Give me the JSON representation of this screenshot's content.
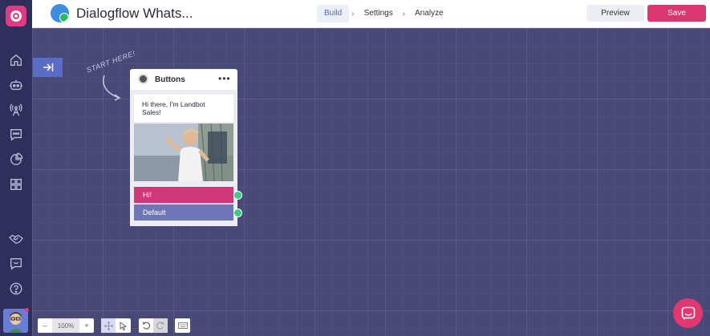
{
  "topbar": {
    "bot_title": "Dialogflow Whats...",
    "nav": [
      {
        "label": "Build",
        "active": true
      },
      {
        "label": "Settings",
        "active": false
      },
      {
        "label": "Analyze",
        "active": false
      }
    ],
    "nav_separator": "›",
    "preview_label": "Preview",
    "save_label": "Save"
  },
  "sidebar": {
    "icons": [
      "home-icon",
      "bot-icon",
      "broadcast-icon",
      "chat-icon",
      "analytics-icon",
      "apps-icon",
      "handshake-icon",
      "feedback-icon",
      "help-icon"
    ]
  },
  "canvas": {
    "start_hint": "START HERE!",
    "node": {
      "title": "Buttons",
      "menu": "•••",
      "message": "Hi there, I'm Landbot Sales!",
      "buttons": [
        "Hi!",
        "Default"
      ]
    }
  },
  "toolbar": {
    "zoom_minus": "–",
    "zoom_level": "100%",
    "zoom_plus": "+"
  },
  "colors": {
    "canvas": "#494978",
    "sidebar": "#2f2f5c",
    "accent_pink": "#d9376f",
    "button_default": "#6e76b6",
    "port_green": "#3ccb7f"
  }
}
